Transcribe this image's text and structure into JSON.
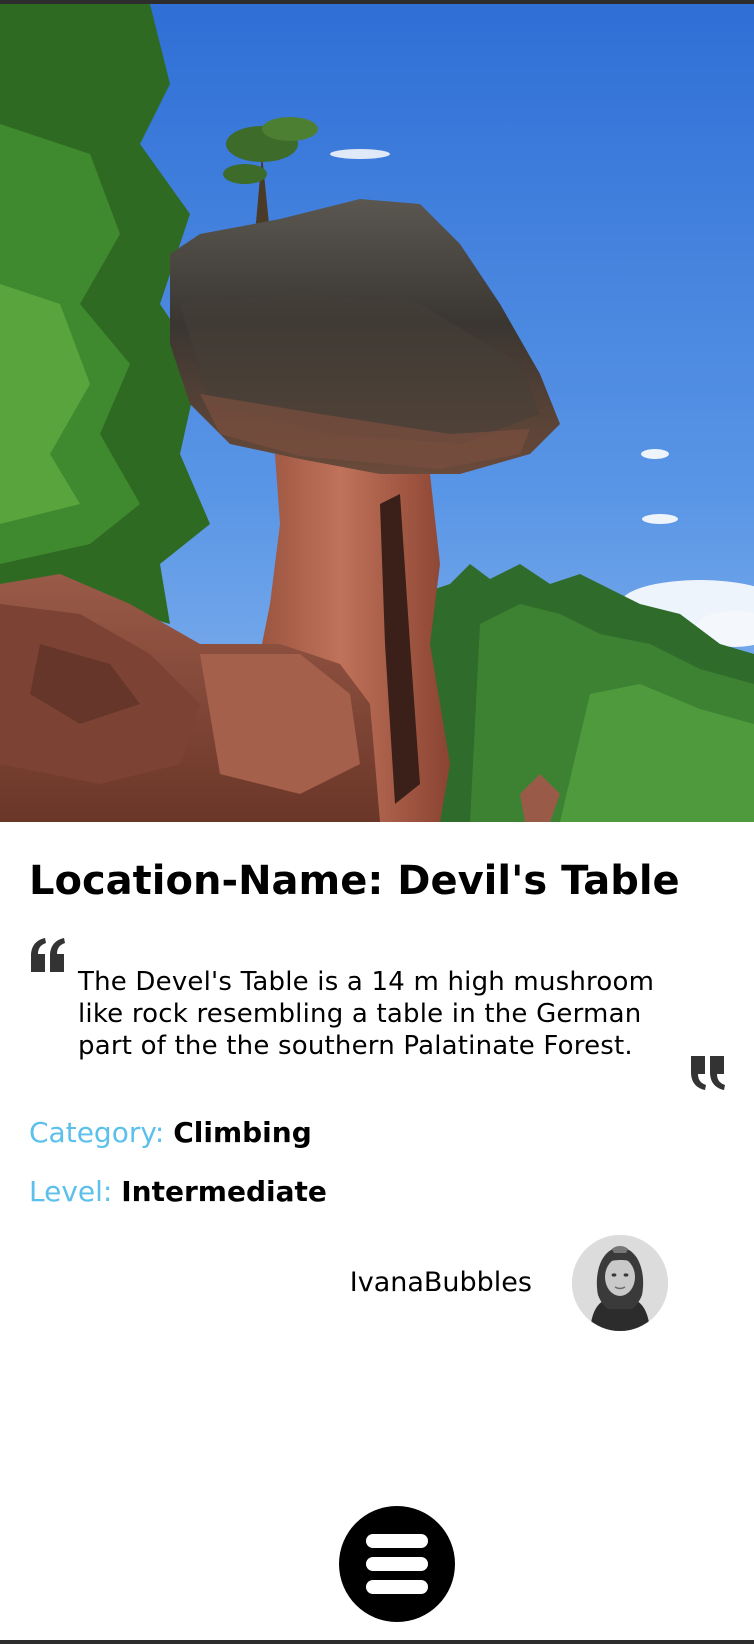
{
  "location": {
    "title": "Location-Name: Devil's Table",
    "description": "The Devel's Table is a 14 m high mushroom like rock resembling a table in the German part of the the southern Palatinate Forest."
  },
  "details": {
    "category_label": "Category:",
    "category_value": "Climbing",
    "level_label": "Level:",
    "level_value": "Intermediate"
  },
  "author": {
    "username": "IvanaBubbles"
  },
  "icons": {
    "quote_open": "quote-open-icon",
    "quote_close": "quote-close-icon",
    "menu": "hamburger-menu-icon"
  },
  "colors": {
    "label_accent": "#5bc0eb",
    "menu_button": "#000000"
  }
}
